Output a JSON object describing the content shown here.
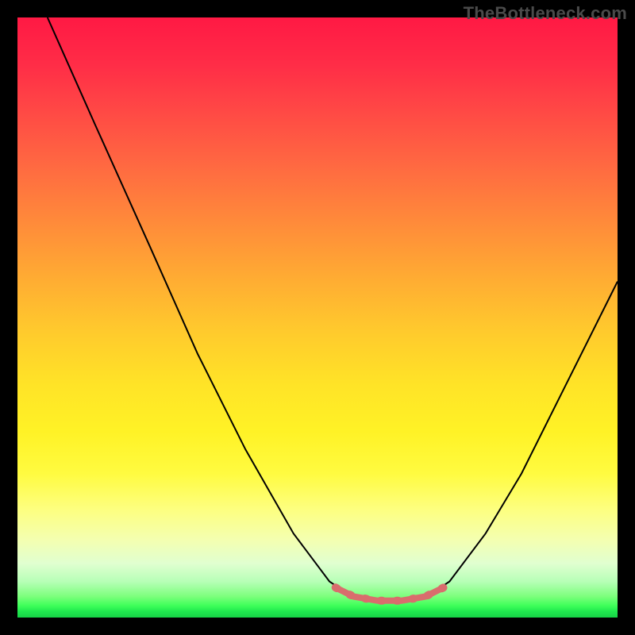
{
  "watermark": "TheBottleneck.com",
  "chart_data": {
    "type": "line",
    "title": "",
    "xlabel": "",
    "ylabel": "",
    "xlim": [
      0,
      100
    ],
    "ylim": [
      0,
      100
    ],
    "series": [
      {
        "name": "black-curve",
        "stroke": "#000000",
        "points": [
          {
            "x": 5,
            "y": 100
          },
          {
            "x": 13,
            "y": 82
          },
          {
            "x": 22,
            "y": 62
          },
          {
            "x": 30,
            "y": 44
          },
          {
            "x": 38,
            "y": 28
          },
          {
            "x": 46,
            "y": 14
          },
          {
            "x": 52,
            "y": 6
          },
          {
            "x": 55,
            "y": 4
          },
          {
            "x": 58,
            "y": 3
          },
          {
            "x": 62,
            "y": 2.5
          },
          {
            "x": 66,
            "y": 3
          },
          {
            "x": 69,
            "y": 4
          },
          {
            "x": 72,
            "y": 6
          },
          {
            "x": 78,
            "y": 14
          },
          {
            "x": 84,
            "y": 24
          },
          {
            "x": 90,
            "y": 36
          },
          {
            "x": 96,
            "y": 48
          },
          {
            "x": 100,
            "y": 56
          }
        ]
      },
      {
        "name": "salmon-highlight",
        "stroke": "#e57373",
        "points": [
          {
            "x": 53,
            "y": 5
          },
          {
            "x": 56,
            "y": 3.5
          },
          {
            "x": 60,
            "y": 2.8
          },
          {
            "x": 64,
            "y": 2.8
          },
          {
            "x": 68,
            "y": 3.5
          },
          {
            "x": 71,
            "y": 5
          }
        ]
      }
    ],
    "gradient_stops": [
      {
        "pos": 0,
        "color": "#ff1944"
      },
      {
        "pos": 50,
        "color": "#ffcc2a"
      },
      {
        "pos": 80,
        "color": "#fdff60"
      },
      {
        "pos": 100,
        "color": "#17d247"
      }
    ]
  }
}
